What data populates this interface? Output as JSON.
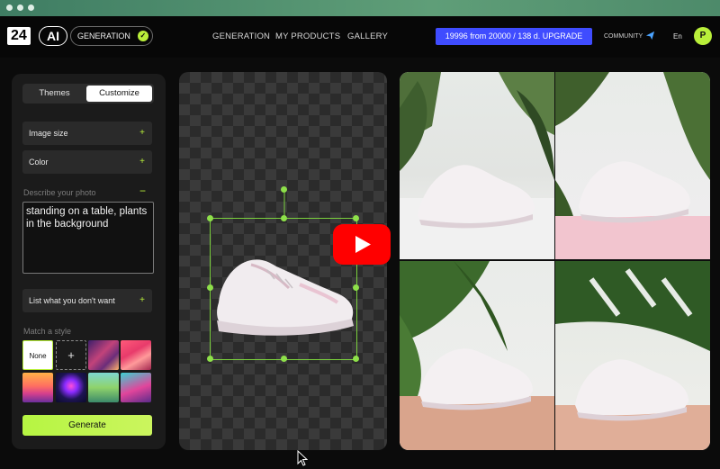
{
  "header": {
    "logo_num": "24",
    "logo_ai": "AI",
    "mode_label": "GENERATION",
    "nav": [
      "GENERATION",
      "MY PRODUCTS",
      "GALLERY"
    ],
    "upgrade_label": "19996 from 20000 / 138 d. UPGRADE",
    "community_label": "COMMUNITY",
    "language": "En",
    "avatar_initial": "P"
  },
  "sidebar": {
    "tabs": [
      "Themes",
      "Customize"
    ],
    "active_tab": "Customize",
    "image_size_label": "Image size",
    "color_label": "Color",
    "describe_label": "Describe your photo",
    "describe_value": "standing on a table, plants in the background",
    "negative_label": "List what you don't want",
    "match_style_label": "Match a style",
    "style_none": "None",
    "style_add": "+",
    "generate_label": "Generate"
  },
  "colors": {
    "accent_green": "#b9ef3a",
    "upgrade_blue": "#3f4cff",
    "youtube_red": "#ff0000"
  },
  "icons": [
    "check-icon",
    "send-icon",
    "plus-icon",
    "minus-icon",
    "youtube-play-icon",
    "cursor-icon"
  ]
}
